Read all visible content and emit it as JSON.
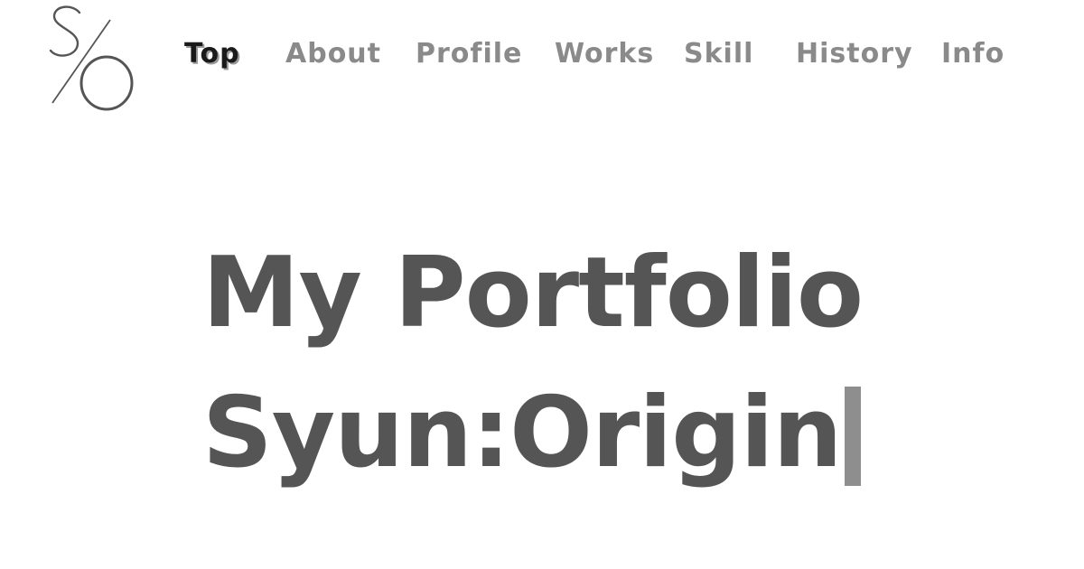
{
  "nav": {
    "items": [
      {
        "label": "Top",
        "active": true
      },
      {
        "label": "About"
      },
      {
        "label": "Profile"
      },
      {
        "label": "Works"
      },
      {
        "label": "Skill"
      },
      {
        "label": "History"
      },
      {
        "label": "Info"
      }
    ]
  },
  "hero": {
    "line1": "My Portfolio",
    "line2": "Syun:Origin"
  },
  "logo": {
    "icon": "s-o-monogram-logo"
  },
  "colors": {
    "nav_active": "#1a1a1a",
    "nav_inactive": "#8a8a8a",
    "hero_text": "#555555",
    "cursor": "#8e8e8e",
    "background": "#ffffff"
  }
}
